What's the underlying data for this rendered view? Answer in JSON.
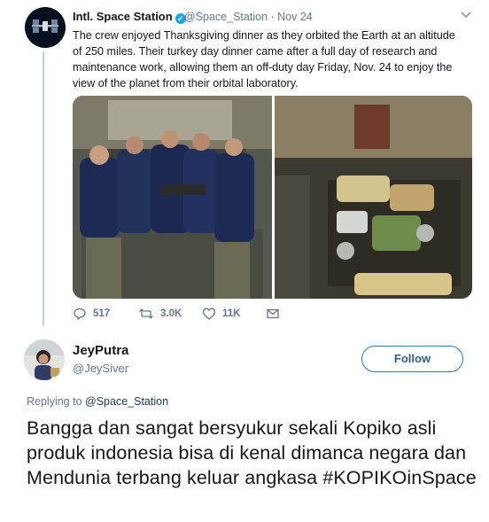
{
  "tweet": {
    "display_name": "Intl. Space Station",
    "verified_glyph": "✓",
    "handle": "@Space_Station",
    "separator": "·",
    "date": "Nov 24",
    "text": "The crew enjoyed Thanksgiving dinner as they orbited the Earth at an altitude of 250 miles. Their turkey day dinner came after a full day of research and maintenance work, allowing them an off-duty day Friday, Nov. 24 to enjoy the view of the planet from their orbital laboratory.",
    "replies": "517",
    "retweets": "3.0K",
    "likes": "11K",
    "icons": [
      "chevron-down-icon",
      "reply-icon",
      "retweet-icon",
      "like-icon",
      "message-icon"
    ]
  },
  "reply": {
    "display_name": "JeyPutra",
    "handle": "@JeySiver",
    "follow_label": "Follow",
    "replying_prefix": "Replying to",
    "replying_to": "@Space_Station",
    "text": "Bangga dan sangat bersyukur sekali Kopiko asli produk indonesia bisa di kenal dimanca negara dan Mendunia terbang keluar angkasa #KOPIKOinSpace"
  },
  "colors": {
    "accent": "#1da1f2",
    "muted": "#657786",
    "thread_line": "#c4cfd6"
  }
}
